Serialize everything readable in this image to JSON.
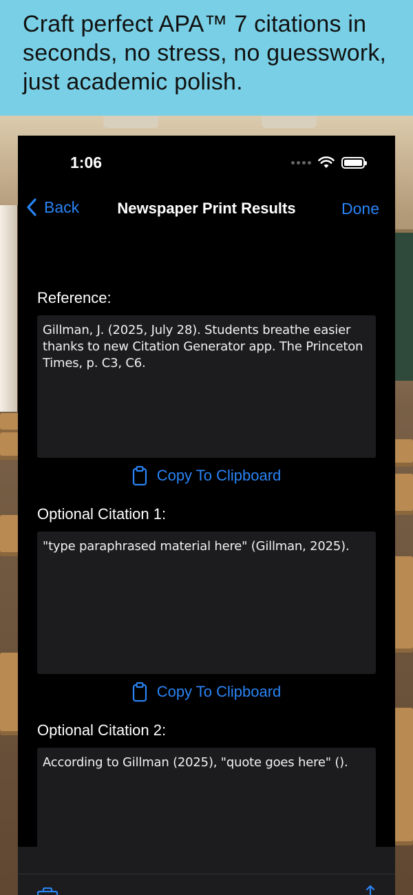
{
  "banner": {
    "text": "Craft perfect APA™ 7 citations in seconds, no stress, no guesswork, just academic polish."
  },
  "status_bar": {
    "time": "1:06"
  },
  "nav": {
    "back_label": "Back",
    "title": "Newspaper Print Results",
    "done_label": "Done"
  },
  "sections": [
    {
      "label": "Reference:",
      "text": "Gillman, J. (2025, July 28). Students breathe easier thanks to new Citation Generator app. The Princeton Times, p. C3, C6.",
      "copy_label": "Copy To Clipboard"
    },
    {
      "label": "Optional Citation 1:",
      "text": "\"type paraphrased material here\" (Gillman, 2025).",
      "copy_label": "Copy To Clipboard"
    },
    {
      "label": "Optional Citation 2:",
      "text": "According to Gillman (2025), \"quote goes here\" ()."
    }
  ],
  "icons": {
    "back": "chevron-left-icon",
    "copy": "clipboard-icon",
    "tab_left": "briefcase-icon",
    "tab_right": "share-icon"
  },
  "colors": {
    "accent": "#2a84f5",
    "banner_bg": "#79d0e6",
    "screen_bg": "#000000",
    "field_bg": "#1c1c1e"
  }
}
